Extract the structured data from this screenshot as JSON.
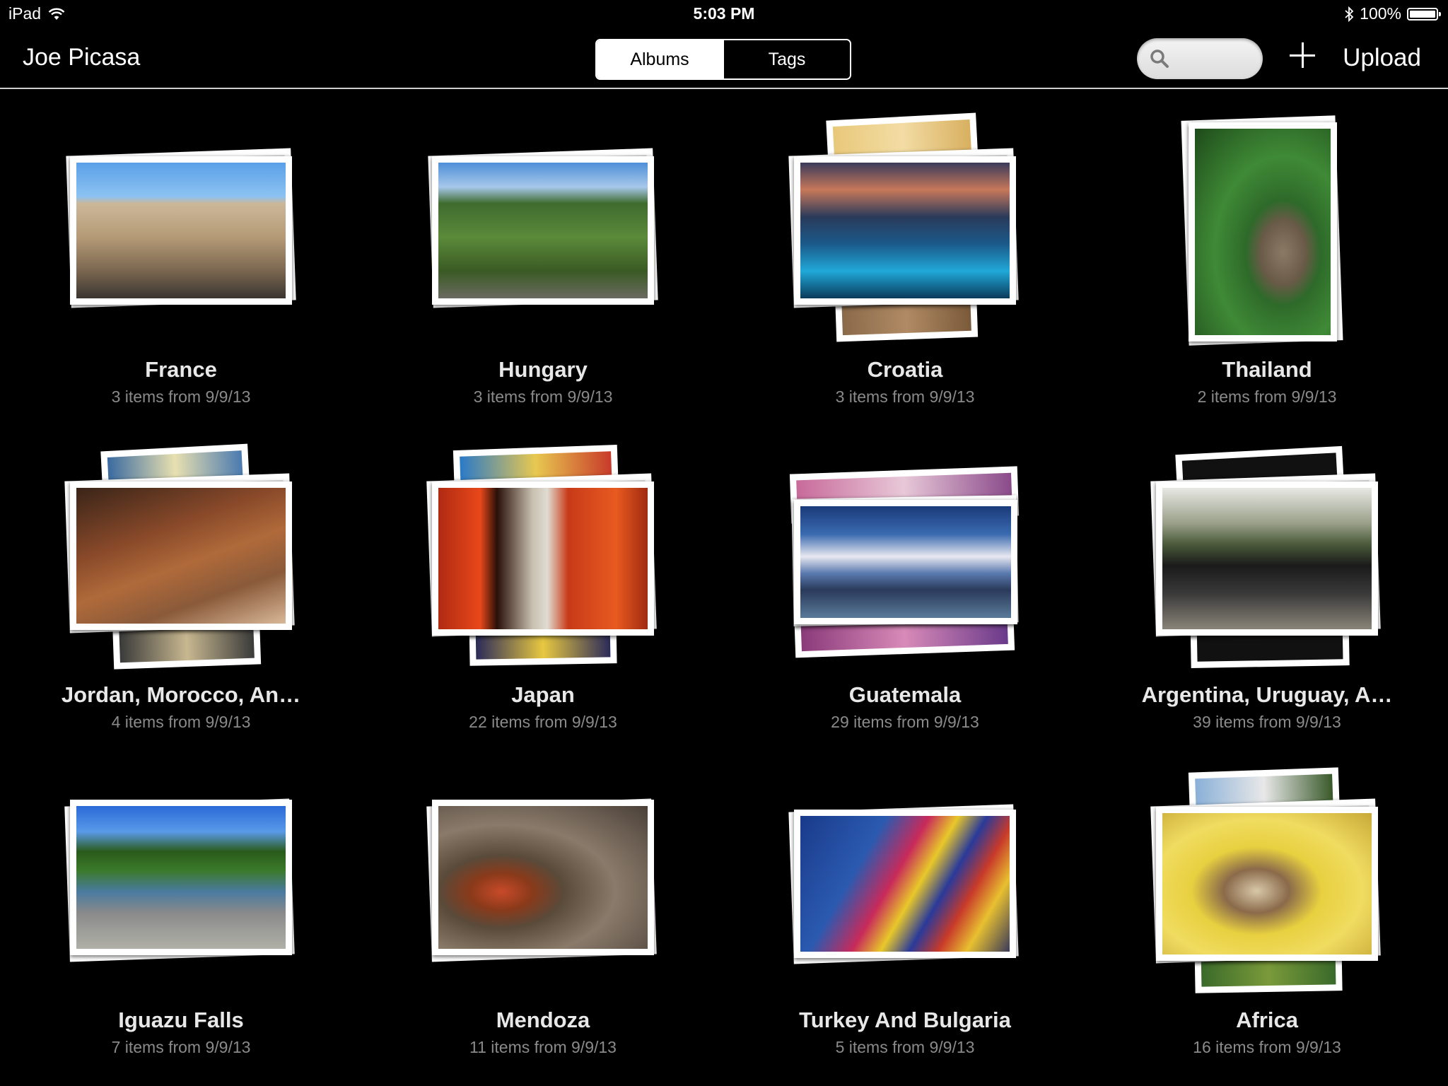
{
  "status": {
    "device": "iPad",
    "time": "5:03 PM",
    "battery": "100%"
  },
  "nav": {
    "title": "Joe Picasa",
    "segments": [
      "Albums",
      "Tags"
    ],
    "selected_segment": "Albums",
    "search_placeholder": "",
    "upload_label": "Upload"
  },
  "albums": [
    {
      "name": "France",
      "meta": "3 items from 9/9/13"
    },
    {
      "name": "Hungary",
      "meta": "3 items from 9/9/13"
    },
    {
      "name": "Croatia",
      "meta": "3 items from 9/9/13"
    },
    {
      "name": "Thailand",
      "meta": "2 items from 9/9/13"
    },
    {
      "name": "Jordan, Morocco, An…",
      "meta": "4 items from 9/9/13"
    },
    {
      "name": "Japan",
      "meta": "22 items from 9/9/13"
    },
    {
      "name": "Guatemala",
      "meta": "29 items from 9/9/13"
    },
    {
      "name": "Argentina, Uruguay, A…",
      "meta": "39 items from 9/9/13"
    },
    {
      "name": "Iguazu Falls",
      "meta": "7 items from 9/9/13"
    },
    {
      "name": "Mendoza",
      "meta": "11 items from 9/9/13"
    },
    {
      "name": "Turkey And Bulgaria",
      "meta": "5 items from 9/9/13"
    },
    {
      "name": "Africa",
      "meta": "16 items from 9/9/13"
    }
  ]
}
